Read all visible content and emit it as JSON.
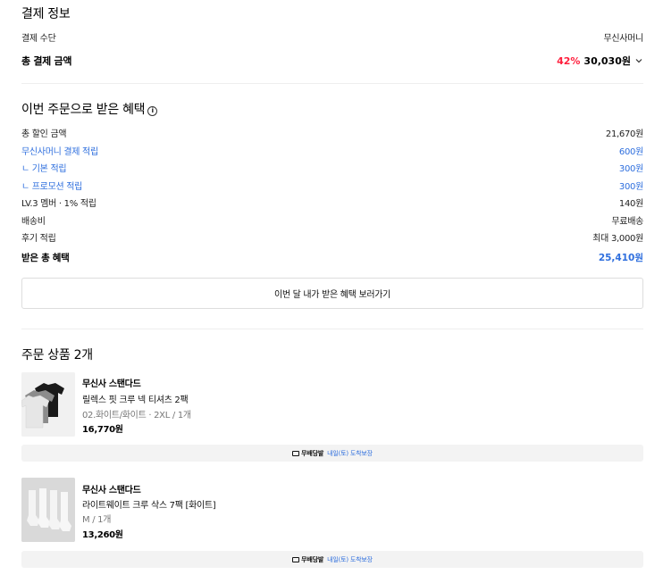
{
  "payment": {
    "title": "결제 정보",
    "method_label": "결제 수단",
    "method_value": "무신사머니",
    "total_label": "총 결제 금액",
    "discount_rate": "42%",
    "total_value": "30,030원"
  },
  "benefits": {
    "title": "이번 주문으로 받은 혜택",
    "rows": [
      {
        "label": "총 할인 금액",
        "value": "21,670원"
      },
      {
        "label": "무신사머니 결제 적립",
        "value": "600원"
      },
      {
        "label": "ㄴ 기본 적립",
        "value": "300원"
      },
      {
        "label": "ㄴ 프로모션 적립",
        "value": "300원"
      },
      {
        "label": "LV.3 멤버 · 1% 적립",
        "value": "140원"
      },
      {
        "label": "배송비",
        "value": "무료배송"
      },
      {
        "label": "후기 적립",
        "value": "최대 3,000원"
      }
    ],
    "total_label": "받은 총 혜택",
    "total_value": "25,410원",
    "button_label": "이번 달 내가 받은 혜택 보러가기"
  },
  "order": {
    "title": "주문 상품 2개",
    "items": [
      {
        "brand": "무신사 스탠다드",
        "name": "릴렉스 핏 크루 넥 티셔츠 2팩",
        "option": "02.화이트/화이트 · 2XL / 1개",
        "price": "16,770원",
        "delivery_badge": "무배당발",
        "delivery_text": "내일(토) 도착보장"
      },
      {
        "brand": "무신사 스탠다드",
        "name": "라이트웨이트 크루 삭스 7팩 [화이트]",
        "option": "M / 1개",
        "price": "13,260원",
        "delivery_badge": "무배당발",
        "delivery_text": "내일(토) 도착보장"
      }
    ]
  },
  "colors": {
    "accent_blue": "#2f6fde",
    "discount_red": "#ff1f3d"
  }
}
